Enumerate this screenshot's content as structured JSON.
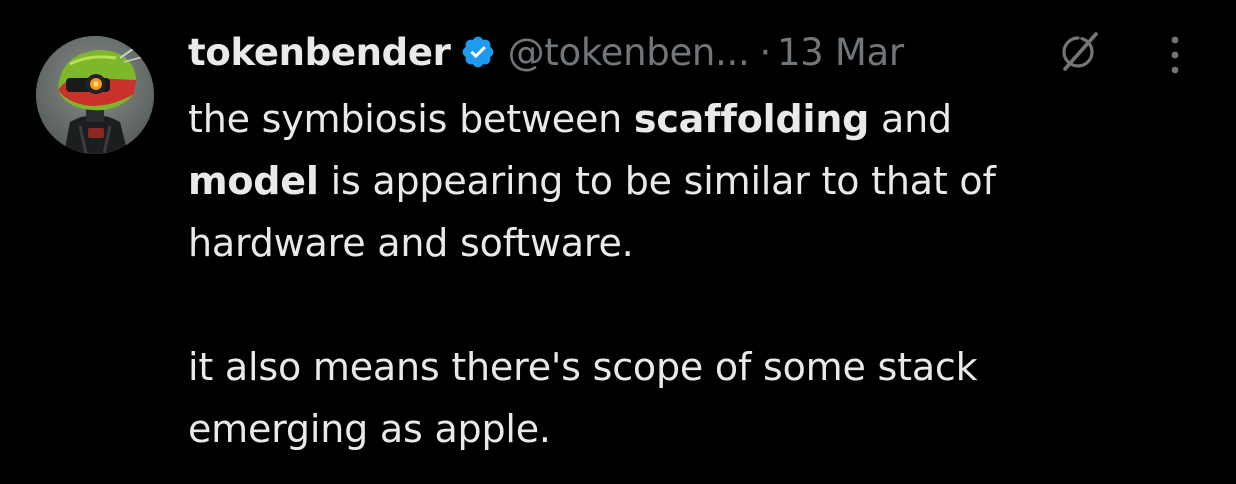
{
  "tweet": {
    "author": {
      "display_name": "tokenbender",
      "handle": "@tokenben...",
      "verified": true,
      "avatar_icon": "robot-avatar"
    },
    "separator": "·",
    "timestamp": "13 Mar",
    "actions": {
      "grok_icon": "grok-slash-icon",
      "more_icon": "more-vertical-icon"
    },
    "text": {
      "p1_part1": "the symbiosis between ",
      "p1_bold1": "scaffolding",
      "p1_part2": " and",
      "p1_bold2": "model",
      "p1_part3": " is appearing to be similar to that of",
      "p1_part4": "hardware and software.",
      "p2_line1": "it also means there's scope of some stack",
      "p2_line2": "emerging as apple."
    }
  },
  "colors": {
    "background": "#000000",
    "primary_text": "#e7e9ea",
    "secondary_text": "#71767b",
    "verified_blue": "#1d9bf0"
  }
}
